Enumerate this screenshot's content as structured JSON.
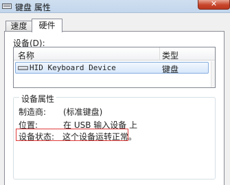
{
  "window": {
    "title": "键盘 属性",
    "close_glyph": "✕"
  },
  "tabs": [
    {
      "label": "速度",
      "selected": false
    },
    {
      "label": "硬件",
      "selected": true
    }
  ],
  "devices": {
    "label": "设备(D):",
    "columns": {
      "name": "名称",
      "type": "类型"
    },
    "rows": [
      {
        "name": "HID Keyboard Device",
        "type": "键盘",
        "icon": "keyboard-icon",
        "selected": true
      }
    ]
  },
  "properties": {
    "title": "设备属性",
    "manufacturer": {
      "label": "制造商:",
      "value": "(标准键盘)"
    },
    "location": {
      "label": "位置:",
      "value": "在 USB 输入设备 上"
    },
    "status": {
      "label": "设备状态:",
      "value": "这个设备运转正常。"
    }
  },
  "colors": {
    "highlight_border": "#e03a3a",
    "selection": "#d7e8fb"
  }
}
